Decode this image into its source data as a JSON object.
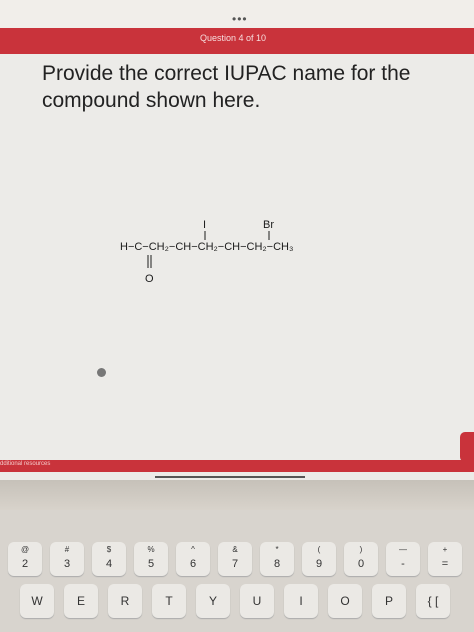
{
  "header": {
    "question_counter": "Question 4 of 10",
    "dots": "•••"
  },
  "question": {
    "text": "Provide the correct IUPAC name for the compound shown here."
  },
  "molecule": {
    "main_chain": "H−C−CH₂−CH−CH₂−CH−CH₂−CH₃",
    "substituent_1": "I",
    "substituent_2": "Br",
    "carbonyl_o": "O"
  },
  "footer": {
    "resources_label": "dditional resources"
  },
  "keyboard": {
    "row1": [
      {
        "top": "@",
        "bottom": "2"
      },
      {
        "top": "#",
        "bottom": "3"
      },
      {
        "top": "$",
        "bottom": "4"
      },
      {
        "top": "%",
        "bottom": "5"
      },
      {
        "top": "^",
        "bottom": "6"
      },
      {
        "top": "&",
        "bottom": "7"
      },
      {
        "top": "*",
        "bottom": "8"
      },
      {
        "top": "(",
        "bottom": "9"
      },
      {
        "top": ")",
        "bottom": "0"
      },
      {
        "top": "—",
        "bottom": "-"
      },
      {
        "top": "+",
        "bottom": "="
      }
    ],
    "row2": [
      "W",
      "E",
      "R",
      "T",
      "Y",
      "U",
      "I",
      "O",
      "P",
      "{ ["
    ]
  }
}
